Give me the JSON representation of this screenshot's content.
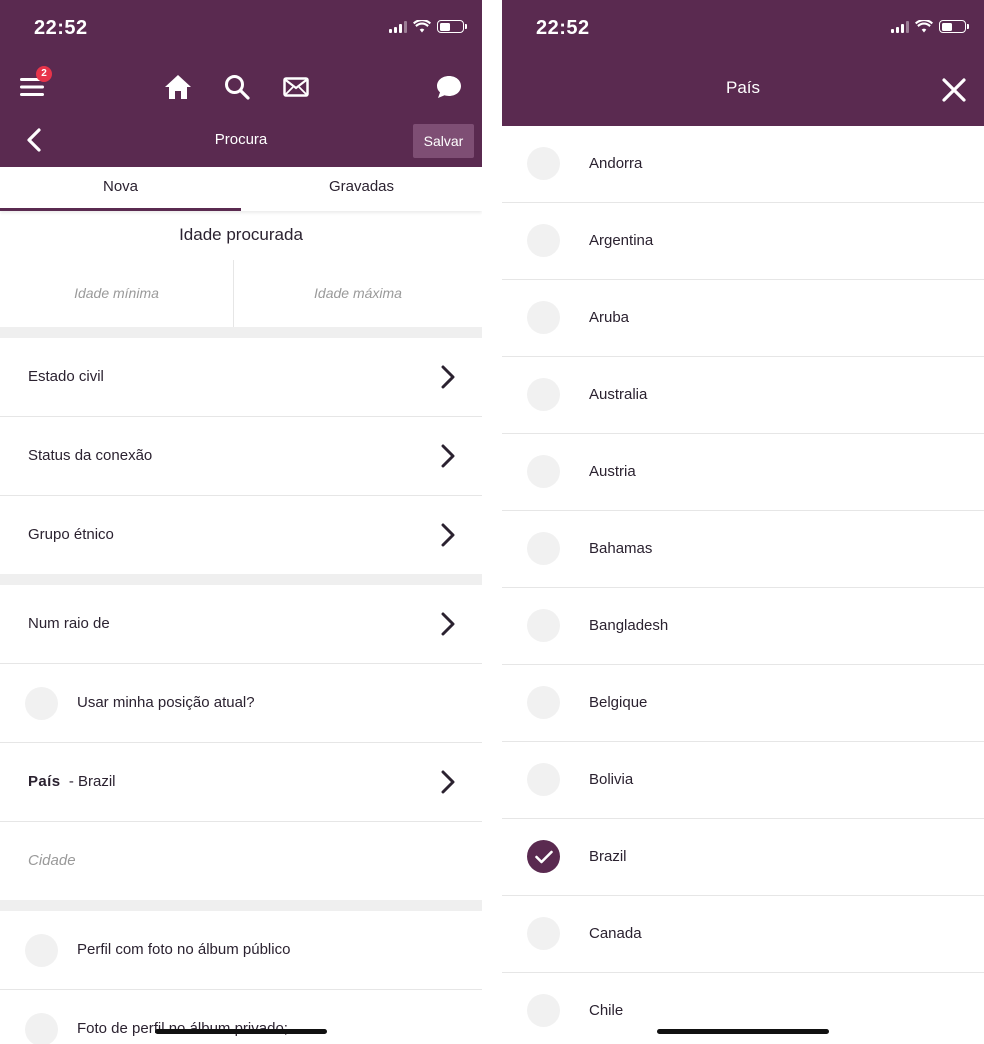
{
  "status_bar": {
    "time": "22:52"
  },
  "left": {
    "nav": {
      "menu_badge": "2"
    },
    "title": "Procura",
    "save_label": "Salvar",
    "tabs": [
      {
        "label": "Nova",
        "active": true
      },
      {
        "label": "Gravadas",
        "active": false
      }
    ],
    "age_section": {
      "title": "Idade procurada",
      "min_placeholder": "Idade mínima",
      "max_placeholder": "Idade máxima"
    },
    "rows": {
      "estado_civil": "Estado civil",
      "status_conexao": "Status da conexão",
      "grupo_etnico": "Grupo étnico",
      "num_raio": "Num raio de",
      "usar_posicao": "Usar minha posição atual?",
      "pais_label": "País",
      "pais_value": "- Brazil",
      "cidade_placeholder": "Cidade",
      "perfil_publico": "Perfil com foto no álbum público",
      "perfil_privado": "Foto de perfil no álbum privado;"
    }
  },
  "right": {
    "title": "País",
    "countries": [
      {
        "name": "Andorra",
        "selected": false
      },
      {
        "name": "Argentina",
        "selected": false
      },
      {
        "name": "Aruba",
        "selected": false
      },
      {
        "name": "Australia",
        "selected": false
      },
      {
        "name": "Austria",
        "selected": false
      },
      {
        "name": "Bahamas",
        "selected": false
      },
      {
        "name": "Bangladesh",
        "selected": false
      },
      {
        "name": "Belgique",
        "selected": false
      },
      {
        "name": "Bolivia",
        "selected": false
      },
      {
        "name": "Brazil",
        "selected": true
      },
      {
        "name": "Canada",
        "selected": false
      },
      {
        "name": "Chile",
        "selected": false
      }
    ]
  },
  "colors": {
    "header": "#5a2a50",
    "save_button": "#7e4e74",
    "badge": "#e7344a",
    "radio_idle": "#f1f1f1"
  },
  "icons": [
    "menu-icon",
    "home-icon",
    "search-icon",
    "mail-icon",
    "chat-icon",
    "back-icon",
    "chevron-right-icon",
    "close-icon",
    "check-icon"
  ]
}
